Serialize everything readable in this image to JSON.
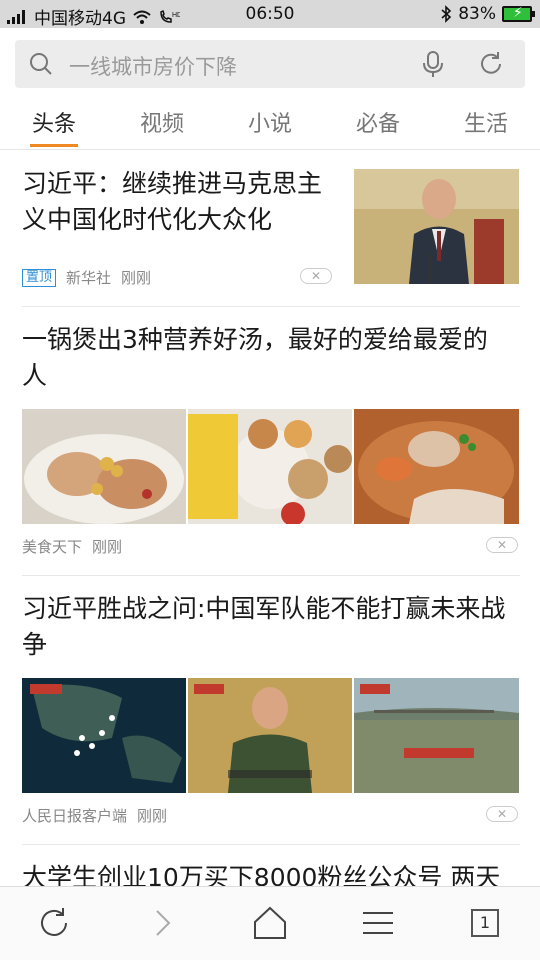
{
  "status_bar": {
    "carrier": "中国移动4G",
    "time": "06:50",
    "battery": "83%"
  },
  "search": {
    "placeholder": "一线城市房价下降",
    "icons": [
      "search-icon",
      "mic-icon",
      "refresh-icon"
    ]
  },
  "tabs": [
    {
      "label": "头条",
      "active": true
    },
    {
      "label": "视频",
      "active": false
    },
    {
      "label": "小说",
      "active": false
    },
    {
      "label": "必备",
      "active": false
    },
    {
      "label": "生活",
      "active": false
    }
  ],
  "articles": [
    {
      "title_line1": "习近平：继续推进马克思主",
      "title_line2": "义中国化时代化大众化",
      "badge": "置顶",
      "source": "新华社",
      "time": "刚刚"
    },
    {
      "title_line1": "一锅煲出3种营养好汤，最好的爱给最爱的",
      "title_line2": "人",
      "source": "美食天下",
      "time": "刚刚"
    },
    {
      "title_line1": "习近平胜战之问:中国军队能不能打赢未来战",
      "title_line2": "争",
      "source": "人民日报客户端",
      "time": "刚刚"
    },
    {
      "title_line1": "大学生创业10万买下8000粉丝公众号 两天"
    }
  ],
  "toolbar": {
    "tab_count": "1",
    "icons": [
      "refresh-icon",
      "forward-icon",
      "home-icon",
      "menu-icon",
      "tabs-icon"
    ]
  },
  "colors": {
    "accent": "#f08a24",
    "badge": "#2e8fd6",
    "battery": "#2fbf3a"
  }
}
